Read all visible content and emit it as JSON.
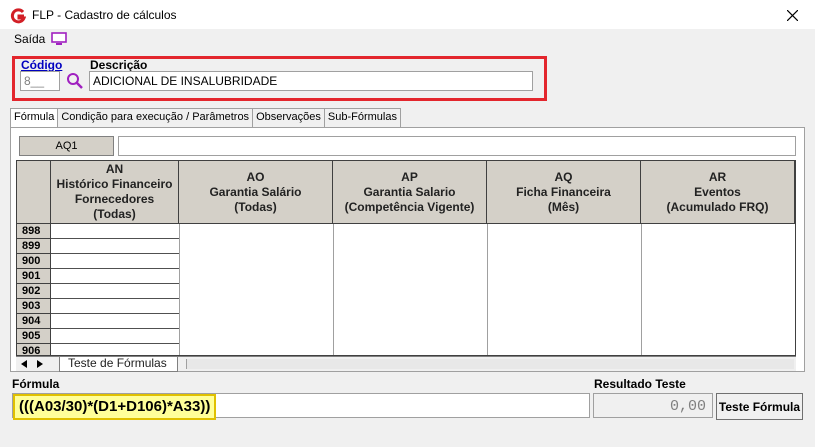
{
  "window": {
    "title": "FLP - Cadastro de cálculos"
  },
  "menu": {
    "saida": "Saída"
  },
  "header": {
    "codigo_label": "Código",
    "codigo_value": "8__",
    "descricao_label": "Descrição",
    "descricao_value": "ADICIONAL DE INSALUBRIDADE"
  },
  "tabs": [
    {
      "label": "Fórmula"
    },
    {
      "label": "Condição para execução / Parâmetros"
    },
    {
      "label": "Observações"
    },
    {
      "label": "Sub-Fórmulas"
    }
  ],
  "grid": {
    "cell_ref": "AQ1",
    "columns": [
      {
        "letter": "AN",
        "l1": "Histórico Financeiro",
        "l2": "Fornecedores",
        "l3": "(Todas)"
      },
      {
        "letter": "AO",
        "l1": "Garantia Salário",
        "l2": "(Todas)",
        "l3": ""
      },
      {
        "letter": "AP",
        "l1": "Garantia Salario",
        "l2": "(Competência Vigente)",
        "l3": ""
      },
      {
        "letter": "AQ",
        "l1": "Ficha Financeira",
        "l2": "(Mês)",
        "l3": ""
      },
      {
        "letter": "AR",
        "l1": "Eventos",
        "l2": "(Acumulado FRQ)",
        "l3": ""
      }
    ],
    "rows": [
      "898",
      "899",
      "900",
      "901",
      "902",
      "903",
      "904",
      "905",
      "906"
    ],
    "sheet_tab": "Teste de Fórmulas"
  },
  "formula": {
    "label": "Fórmula",
    "value": "(((A03/30)*(D1+D106)*A33))"
  },
  "result": {
    "label": "Resultado Teste",
    "value": "0,00",
    "button": "Teste Fórmula"
  },
  "colors": {
    "highlight_border": "#e3262d",
    "formula_highlight": "#ffff99",
    "grid_header": "#d4d0c8"
  }
}
